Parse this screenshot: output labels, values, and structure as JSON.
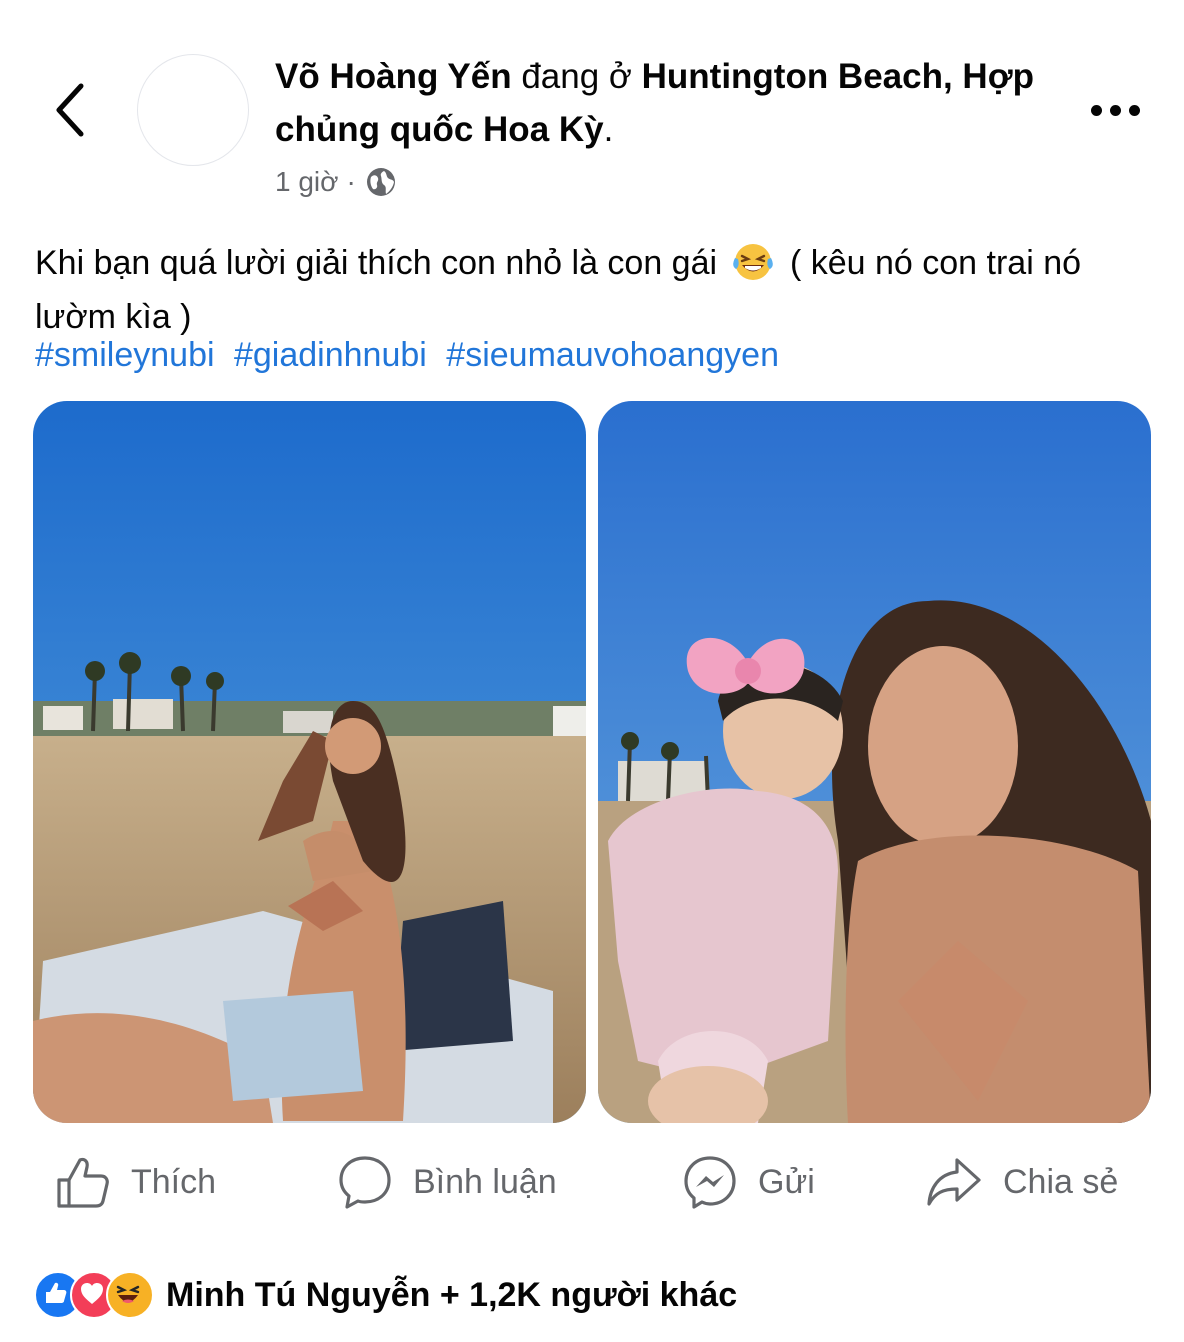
{
  "header": {
    "author": "Võ Hoàng Yến",
    "status_text": "đang ở",
    "location": "Huntington Beach, Hợp chủng quốc Hoa Kỳ",
    "location_end": ".",
    "time": "1 giờ",
    "separator": "·",
    "audience_icon": "globe-icon",
    "back_icon": "chevron-left-icon",
    "more_icon": "more-horizontal-icon"
  },
  "post": {
    "caption": "Khi bạn quá lười giải thích con nhỏ là con gái",
    "emoji": "face-with-tears-of-joy",
    "caption_end": "( kêu nó con trai nó lườm kìa )",
    "hashtags": [
      "#smileynubi",
      "#giadinhnubi",
      "#sieumauvohoangyen"
    ]
  },
  "photos": [
    {
      "description_icon": "photo-beach-woman"
    },
    {
      "description_icon": "photo-beach-woman-baby"
    }
  ],
  "actions": {
    "like": "Thích",
    "comment": "Bình luận",
    "send": "Gửi",
    "share": "Chia sẻ"
  },
  "reactions": {
    "icons": [
      "like-icon",
      "love-icon",
      "haha-icon"
    ],
    "text": "Minh Tú Nguyễn + 1,2K người khác"
  },
  "colors": {
    "link": "#2176d9",
    "secondary_text": "#65676b",
    "like_blue": "#1877f2",
    "love_red": "#f33e58",
    "haha_yellow": "#f7b125"
  }
}
